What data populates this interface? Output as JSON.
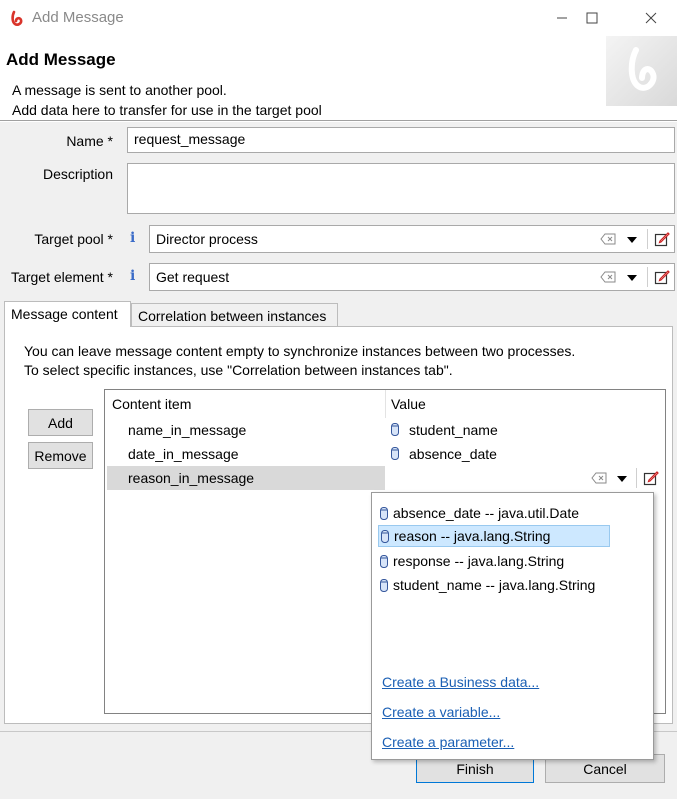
{
  "window": {
    "title": "Add Message"
  },
  "header": {
    "title": "Add Message",
    "description_line1": "A message is sent to another pool.",
    "description_line2": "Add data here to transfer for use in the target pool"
  },
  "form": {
    "name_label": "Name *",
    "name_value": "request_message",
    "description_label": "Description",
    "description_value": "",
    "target_pool_label": "Target pool *",
    "target_pool_value": "Director process",
    "target_element_label": "Target element *",
    "target_element_value": "Get request",
    "info_glyph": "i"
  },
  "tabs": [
    {
      "label": "Message content",
      "active": true
    },
    {
      "label": "Correlation between instances",
      "active": false
    }
  ],
  "message_content": {
    "hint_line1": "You can leave message content empty to synchronize instances between two processes.",
    "hint_line2": "To select specific instances, use \"Correlation between instances tab\".",
    "add_label": "Add",
    "remove_label": "Remove",
    "columns": [
      "Content item",
      "Value"
    ],
    "rows": [
      {
        "item": "name_in_message",
        "value": "student_name"
      },
      {
        "item": "date_in_message",
        "value": "absence_date"
      },
      {
        "item": "reason_in_message",
        "value": ""
      }
    ]
  },
  "value_dropdown": {
    "options": [
      "absence_date -- java.util.Date",
      "reason -- java.lang.String",
      "response -- java.lang.String",
      "student_name -- java.lang.String"
    ],
    "selected_index": 1,
    "links": [
      "Create a Business data...",
      "Create a variable...",
      "Create a parameter..."
    ]
  },
  "footer": {
    "finish_label": "Finish",
    "cancel_label": "Cancel"
  },
  "colors": {
    "accent": "#3a6bc8",
    "selection": "#cde8ff",
    "link": "#1a5fb4",
    "brand": "#d9342b"
  },
  "icons": [
    "bonita-logo-icon",
    "minimize-icon",
    "maximize-icon",
    "close-icon",
    "info-icon",
    "clear-icon",
    "chevron-down-icon",
    "edit-icon",
    "data-icon"
  ]
}
